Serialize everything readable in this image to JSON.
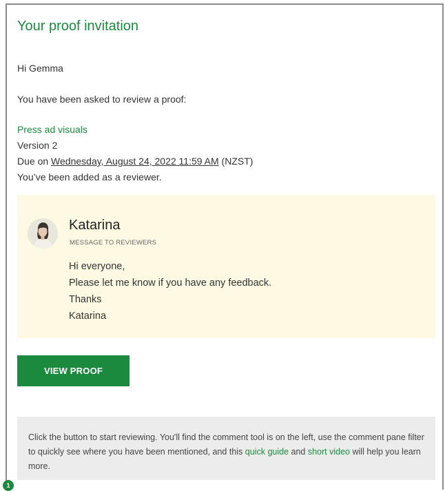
{
  "email": {
    "title": "Your proof invitation",
    "greeting": "Hi Gemma",
    "intro": "You have been asked to review a proof:",
    "proof_name": "Press ad visuals",
    "version": "Version 2",
    "due_prefix": "Due on ",
    "due_date": "Wednesday, August 24, 2022 11:59 AM",
    "due_suffix": " (NZST)",
    "added_text": "You’ve been added as a reviewer."
  },
  "message": {
    "sender_name": "Katarina",
    "sender_role": "MESSAGE TO REVIEWERS",
    "lines": [
      "Hi everyone,",
      "Please let me know if you have any feedback.",
      "Thanks",
      "Katarina"
    ]
  },
  "button": {
    "view_proof_label": "VIEW PROOF"
  },
  "footer": {
    "text_before": "Click the button to start reviewing. You'll find the comment tool is on the left, use the comment pane filter to quickly see where you have been mentioned, and this ",
    "quick_guide": "quick guide",
    "text_and": " and ",
    "short_video": "short video",
    "text_after": " will help you learn more."
  },
  "badge": {
    "count": "1"
  },
  "colors": {
    "accent": "#1b8a3e",
    "message_bg": "#fdf9e2",
    "footer_bg": "#ececec"
  }
}
